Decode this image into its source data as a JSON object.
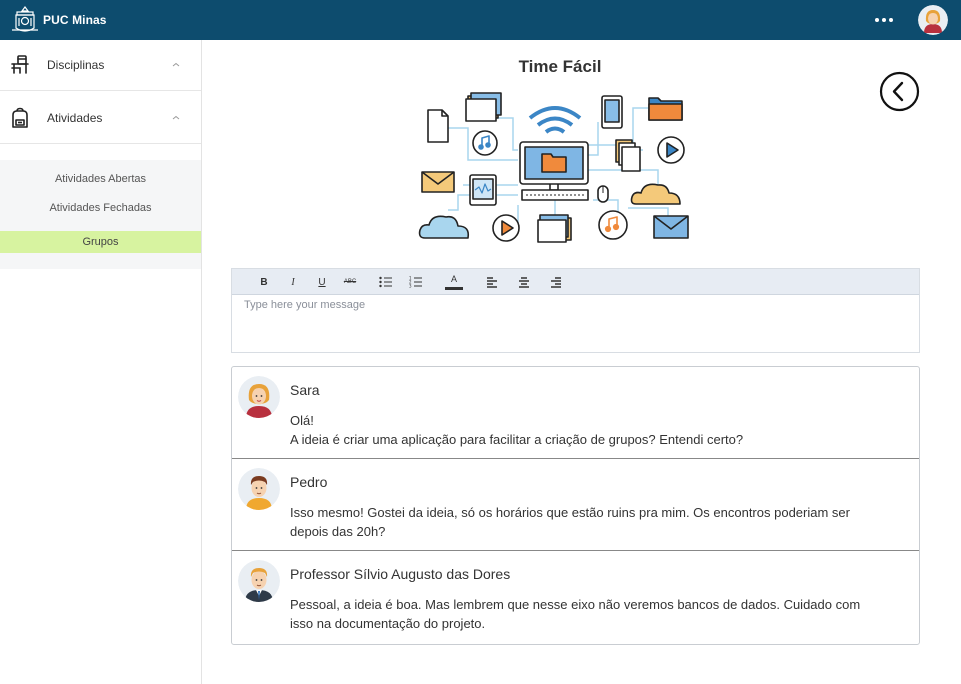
{
  "header": {
    "brand": "PUC Minas",
    "brand_color": "#0d4c6e"
  },
  "sidebar": {
    "items": [
      {
        "label": "Disciplinas",
        "icon": "desk-chair-icon"
      },
      {
        "label": "Atividades",
        "icon": "backpack-icon"
      }
    ],
    "submenu": [
      {
        "label": "Atividades Abertas"
      },
      {
        "label": "Atividades Fechadas"
      },
      {
        "label": "Grupos",
        "active": true
      }
    ],
    "active_color": "#d7f3a0"
  },
  "main": {
    "title": "Time Fácil"
  },
  "editor": {
    "placeholder": "Type here your message",
    "toolbar": [
      "B",
      "I",
      "U",
      "ABC",
      "bulleted-list",
      "numbered-list",
      "A",
      "align-left",
      "align-center",
      "align-right"
    ]
  },
  "messages": [
    {
      "author": "Sara",
      "text": "Olá!\nA ideia é criar uma aplicação para facilitar a criação de grupos? Entendi certo?"
    },
    {
      "author": "Pedro",
      "text": "Isso mesmo! Gostei da ideia, só os horários que estão ruins pra mim. Os encontros poderiam ser\n depois das 20h?"
    },
    {
      "author": "Professor Sílvio Augusto das Dores",
      "text": "Pessoal, a ideia é boa. Mas lembrem que nesse eixo não veremos bancos de dados. Cuidado com\nisso na documentação do projeto."
    }
  ]
}
